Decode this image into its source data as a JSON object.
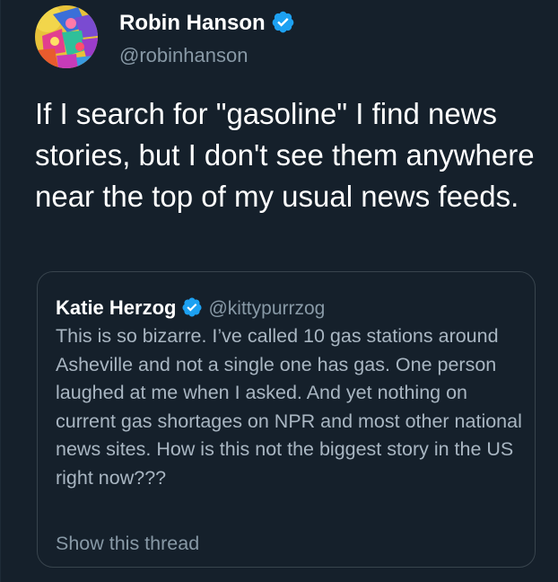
{
  "tweet": {
    "author": {
      "name": "Robin Hanson",
      "handle": "@robinhanson",
      "verified": true,
      "avatar_icon": "colorful-abstract-avatar"
    },
    "text": "If I search for \"gasoline\" I find news stories, but I don't see them anywhere near the top of my usual news feeds.",
    "quoted_tweet": {
      "author_name": "Katie Herzog",
      "author_handle": "@kittypurrzog",
      "verified": true,
      "text": "This is so bizarre. I’ve called 10 gas stations around Asheville and not a single one has gas. One person laughed at me when I asked. And yet nothing on current gas shortages on NPR and most other national news sites. How is this not the biggest story in the US right now???",
      "show_thread_label": "Show this thread"
    }
  },
  "colors": {
    "background": "#15202b",
    "verified_badge": "#1da1f2",
    "secondary_text": "#8899a6",
    "quote_text": "#a9b6c2",
    "border": "#38444d"
  }
}
